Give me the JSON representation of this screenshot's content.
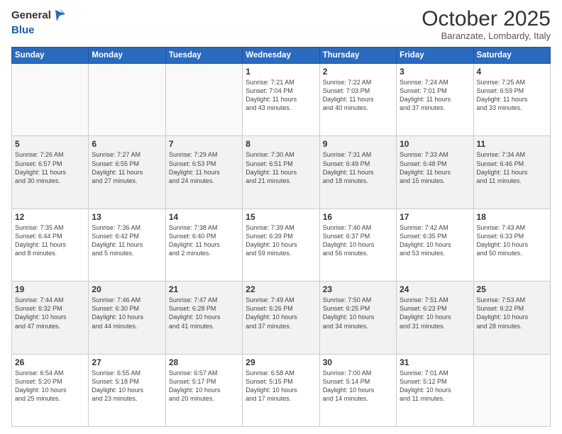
{
  "header": {
    "logo_line1": "General",
    "logo_line2": "Blue",
    "month": "October 2025",
    "location": "Baranzate, Lombardy, Italy"
  },
  "weekdays": [
    "Sunday",
    "Monday",
    "Tuesday",
    "Wednesday",
    "Thursday",
    "Friday",
    "Saturday"
  ],
  "rows": [
    [
      {
        "day": "",
        "info": ""
      },
      {
        "day": "",
        "info": ""
      },
      {
        "day": "",
        "info": ""
      },
      {
        "day": "1",
        "info": "Sunrise: 7:21 AM\nSunset: 7:04 PM\nDaylight: 11 hours\nand 43 minutes."
      },
      {
        "day": "2",
        "info": "Sunrise: 7:22 AM\nSunset: 7:03 PM\nDaylight: 11 hours\nand 40 minutes."
      },
      {
        "day": "3",
        "info": "Sunrise: 7:24 AM\nSunset: 7:01 PM\nDaylight: 11 hours\nand 37 minutes."
      },
      {
        "day": "4",
        "info": "Sunrise: 7:25 AM\nSunset: 6:59 PM\nDaylight: 11 hours\nand 33 minutes."
      }
    ],
    [
      {
        "day": "5",
        "info": "Sunrise: 7:26 AM\nSunset: 6:57 PM\nDaylight: 11 hours\nand 30 minutes."
      },
      {
        "day": "6",
        "info": "Sunrise: 7:27 AM\nSunset: 6:55 PM\nDaylight: 11 hours\nand 27 minutes."
      },
      {
        "day": "7",
        "info": "Sunrise: 7:29 AM\nSunset: 6:53 PM\nDaylight: 11 hours\nand 24 minutes."
      },
      {
        "day": "8",
        "info": "Sunrise: 7:30 AM\nSunset: 6:51 PM\nDaylight: 11 hours\nand 21 minutes."
      },
      {
        "day": "9",
        "info": "Sunrise: 7:31 AM\nSunset: 6:49 PM\nDaylight: 11 hours\nand 18 minutes."
      },
      {
        "day": "10",
        "info": "Sunrise: 7:33 AM\nSunset: 6:48 PM\nDaylight: 11 hours\nand 15 minutes."
      },
      {
        "day": "11",
        "info": "Sunrise: 7:34 AM\nSunset: 6:46 PM\nDaylight: 11 hours\nand 11 minutes."
      }
    ],
    [
      {
        "day": "12",
        "info": "Sunrise: 7:35 AM\nSunset: 6:44 PM\nDaylight: 11 hours\nand 8 minutes."
      },
      {
        "day": "13",
        "info": "Sunrise: 7:36 AM\nSunset: 6:42 PM\nDaylight: 11 hours\nand 5 minutes."
      },
      {
        "day": "14",
        "info": "Sunrise: 7:38 AM\nSunset: 6:40 PM\nDaylight: 11 hours\nand 2 minutes."
      },
      {
        "day": "15",
        "info": "Sunrise: 7:39 AM\nSunset: 6:39 PM\nDaylight: 10 hours\nand 59 minutes."
      },
      {
        "day": "16",
        "info": "Sunrise: 7:40 AM\nSunset: 6:37 PM\nDaylight: 10 hours\nand 56 minutes."
      },
      {
        "day": "17",
        "info": "Sunrise: 7:42 AM\nSunset: 6:35 PM\nDaylight: 10 hours\nand 53 minutes."
      },
      {
        "day": "18",
        "info": "Sunrise: 7:43 AM\nSunset: 6:33 PM\nDaylight: 10 hours\nand 50 minutes."
      }
    ],
    [
      {
        "day": "19",
        "info": "Sunrise: 7:44 AM\nSunset: 6:32 PM\nDaylight: 10 hours\nand 47 minutes."
      },
      {
        "day": "20",
        "info": "Sunrise: 7:46 AM\nSunset: 6:30 PM\nDaylight: 10 hours\nand 44 minutes."
      },
      {
        "day": "21",
        "info": "Sunrise: 7:47 AM\nSunset: 6:28 PM\nDaylight: 10 hours\nand 41 minutes."
      },
      {
        "day": "22",
        "info": "Sunrise: 7:49 AM\nSunset: 6:26 PM\nDaylight: 10 hours\nand 37 minutes."
      },
      {
        "day": "23",
        "info": "Sunrise: 7:50 AM\nSunset: 6:25 PM\nDaylight: 10 hours\nand 34 minutes."
      },
      {
        "day": "24",
        "info": "Sunrise: 7:51 AM\nSunset: 6:23 PM\nDaylight: 10 hours\nand 31 minutes."
      },
      {
        "day": "25",
        "info": "Sunrise: 7:53 AM\nSunset: 6:22 PM\nDaylight: 10 hours\nand 28 minutes."
      }
    ],
    [
      {
        "day": "26",
        "info": "Sunrise: 6:54 AM\nSunset: 5:20 PM\nDaylight: 10 hours\nand 25 minutes."
      },
      {
        "day": "27",
        "info": "Sunrise: 6:55 AM\nSunset: 5:18 PM\nDaylight: 10 hours\nand 23 minutes."
      },
      {
        "day": "28",
        "info": "Sunrise: 6:57 AM\nSunset: 5:17 PM\nDaylight: 10 hours\nand 20 minutes."
      },
      {
        "day": "29",
        "info": "Sunrise: 6:58 AM\nSunset: 5:15 PM\nDaylight: 10 hours\nand 17 minutes."
      },
      {
        "day": "30",
        "info": "Sunrise: 7:00 AM\nSunset: 5:14 PM\nDaylight: 10 hours\nand 14 minutes."
      },
      {
        "day": "31",
        "info": "Sunrise: 7:01 AM\nSunset: 5:12 PM\nDaylight: 10 hours\nand 11 minutes."
      },
      {
        "day": "",
        "info": ""
      }
    ]
  ],
  "row_styles": [
    "white",
    "shaded",
    "white",
    "shaded",
    "white"
  ]
}
